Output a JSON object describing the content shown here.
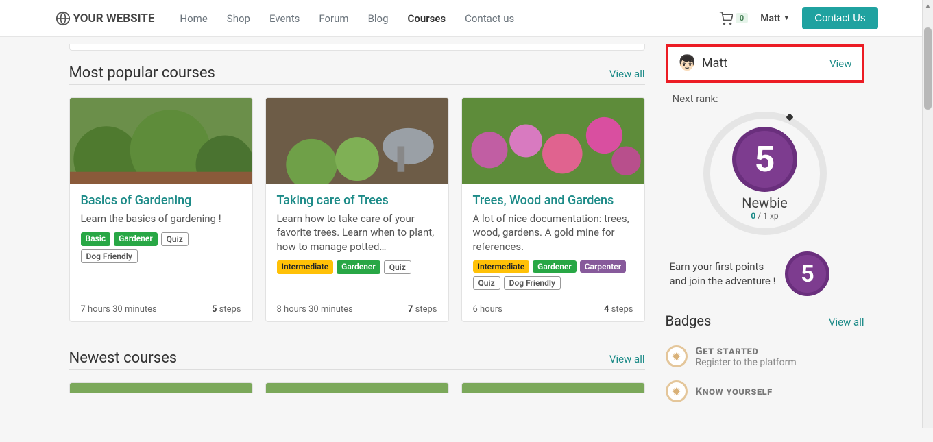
{
  "nav": {
    "brand": "YOUR WEBSITE",
    "links": [
      "Home",
      "Shop",
      "Events",
      "Forum",
      "Blog",
      "Courses",
      "Contact us"
    ],
    "active_index": 5,
    "cart_count": "0",
    "user": "Matt",
    "cta": "Contact Us"
  },
  "sections": {
    "popular": {
      "title": "Most popular courses",
      "view_all": "View all"
    },
    "newest": {
      "title": "Newest courses",
      "view_all": "View all"
    },
    "badges": {
      "title": "Badges",
      "view_all": "View all"
    }
  },
  "courses_popular": [
    {
      "title": "Basics of Gardening",
      "desc": "Learn the basics of gardening !",
      "tags": [
        {
          "label": "Basic",
          "cls": "tag-green"
        },
        {
          "label": "Gardener",
          "cls": "tag-green"
        },
        {
          "label": "Quiz",
          "cls": "tag-outline"
        },
        {
          "label": "Dog Friendly",
          "cls": "tag-outline"
        }
      ],
      "time": "7 hours 30 minutes",
      "steps_n": "5",
      "steps_lbl": " steps"
    },
    {
      "title": "Taking care of Trees",
      "desc": "Learn how to take care of your favorite trees. Learn when to plant, how to manage potted…",
      "tags": [
        {
          "label": "Intermediate",
          "cls": "tag-yellow"
        },
        {
          "label": "Gardener",
          "cls": "tag-green"
        },
        {
          "label": "Quiz",
          "cls": "tag-outline"
        }
      ],
      "time": "8 hours 30 minutes",
      "steps_n": "7",
      "steps_lbl": " steps"
    },
    {
      "title": "Trees, Wood and Gardens",
      "desc": "A lot of nice documentation: trees, wood, gardens. A gold mine for references.",
      "tags": [
        {
          "label": "Intermediate",
          "cls": "tag-yellow"
        },
        {
          "label": "Gardener",
          "cls": "tag-green"
        },
        {
          "label": "Carpenter",
          "cls": "tag-purple"
        },
        {
          "label": "Quiz",
          "cls": "tag-outline"
        },
        {
          "label": "Dog Friendly",
          "cls": "tag-outline"
        }
      ],
      "time": "6 hours",
      "steps_n": "4",
      "steps_lbl": " steps"
    }
  ],
  "profile": {
    "name": "Matt",
    "view": "View",
    "next_rank_label": "Next rank:",
    "rank_glyph": "5",
    "rank_name": "Newbie",
    "xp_cur": "0",
    "xp_sep": " / ",
    "xp_max": "1",
    "xp_unit": " xp",
    "earn_line1": "Earn your first points",
    "earn_line2": "and join the adventure !",
    "small_glyph": "5"
  },
  "badges": [
    {
      "name": "Get started",
      "desc": "Register to the platform"
    },
    {
      "name": "Know yourself",
      "desc": ""
    }
  ]
}
